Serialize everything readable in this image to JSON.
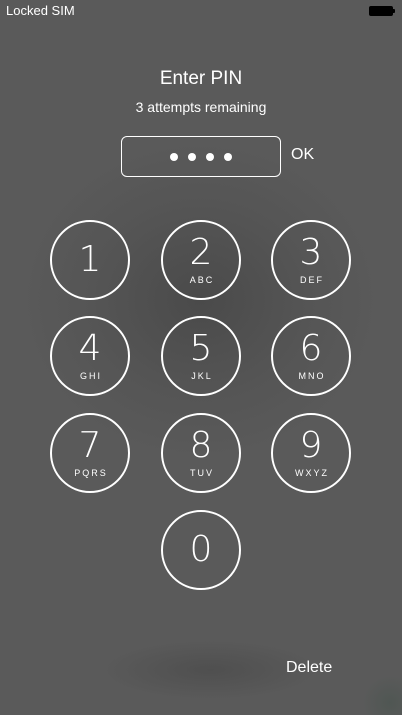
{
  "status_bar": {
    "carrier": "Locked SIM",
    "battery_icon": "battery-full-icon"
  },
  "prompt": {
    "title": "Enter PIN",
    "attempts": "3 attempts remaining"
  },
  "pin_field": {
    "entered_digits": 4,
    "ok_label": "OK"
  },
  "keypad": [
    {
      "digit": "1",
      "letters": ""
    },
    {
      "digit": "2",
      "letters": "ABC"
    },
    {
      "digit": "3",
      "letters": "DEF"
    },
    {
      "digit": "4",
      "letters": "GHI"
    },
    {
      "digit": "5",
      "letters": "JKL"
    },
    {
      "digit": "6",
      "letters": "MNO"
    },
    {
      "digit": "7",
      "letters": "PQRS"
    },
    {
      "digit": "8",
      "letters": "TUV"
    },
    {
      "digit": "9",
      "letters": "WXYZ"
    },
    {
      "digit": "0",
      "letters": ""
    }
  ],
  "actions": {
    "delete_label": "Delete"
  },
  "colors": {
    "background": "#5a5a5a",
    "foreground": "#ffffff"
  }
}
